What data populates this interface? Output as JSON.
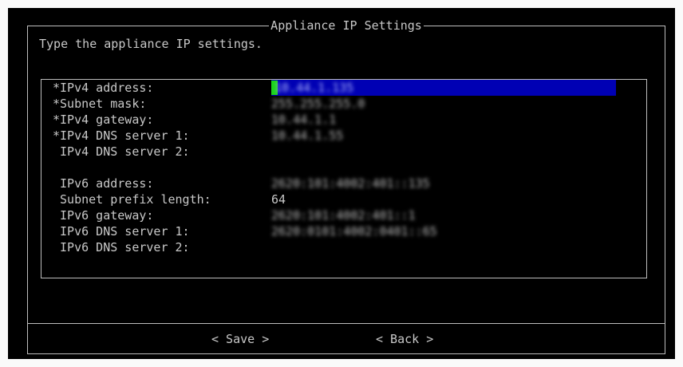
{
  "dialog": {
    "title": "Appliance IP Settings",
    "instruction": "Type the appliance IP settings."
  },
  "fields": [
    {
      "label": "*IPv4 address:",
      "value": "10.44.1.135"
    },
    {
      "label": "*Subnet mask:",
      "value": "255.255.255.0"
    },
    {
      "label": "*IPv4 gateway:",
      "value": "10.44.1.1"
    },
    {
      "label": "*IPv4 DNS server 1:",
      "value": "10.44.1.55"
    },
    {
      "label": " IPv4 DNS server 2:",
      "value": ""
    },
    {
      "label": " IPv6 address:",
      "value": "2620:101:4002:401::135"
    },
    {
      "label": " Subnet prefix length:",
      "value": "64"
    },
    {
      "label": " IPv6 gateway:",
      "value": "2620:101:4002:401::1"
    },
    {
      "label": " IPv6 DNS server 1:",
      "value": "2620:0101:4002:0401::65"
    },
    {
      "label": " IPv6 DNS server 2:",
      "value": ""
    }
  ],
  "buttons": {
    "save": "< Save >",
    "back": "< Back >"
  },
  "colors": {
    "background": "#000000",
    "text": "#c8c8c8",
    "active_field": "#0000b4",
    "cursor": "#1cd41c"
  }
}
